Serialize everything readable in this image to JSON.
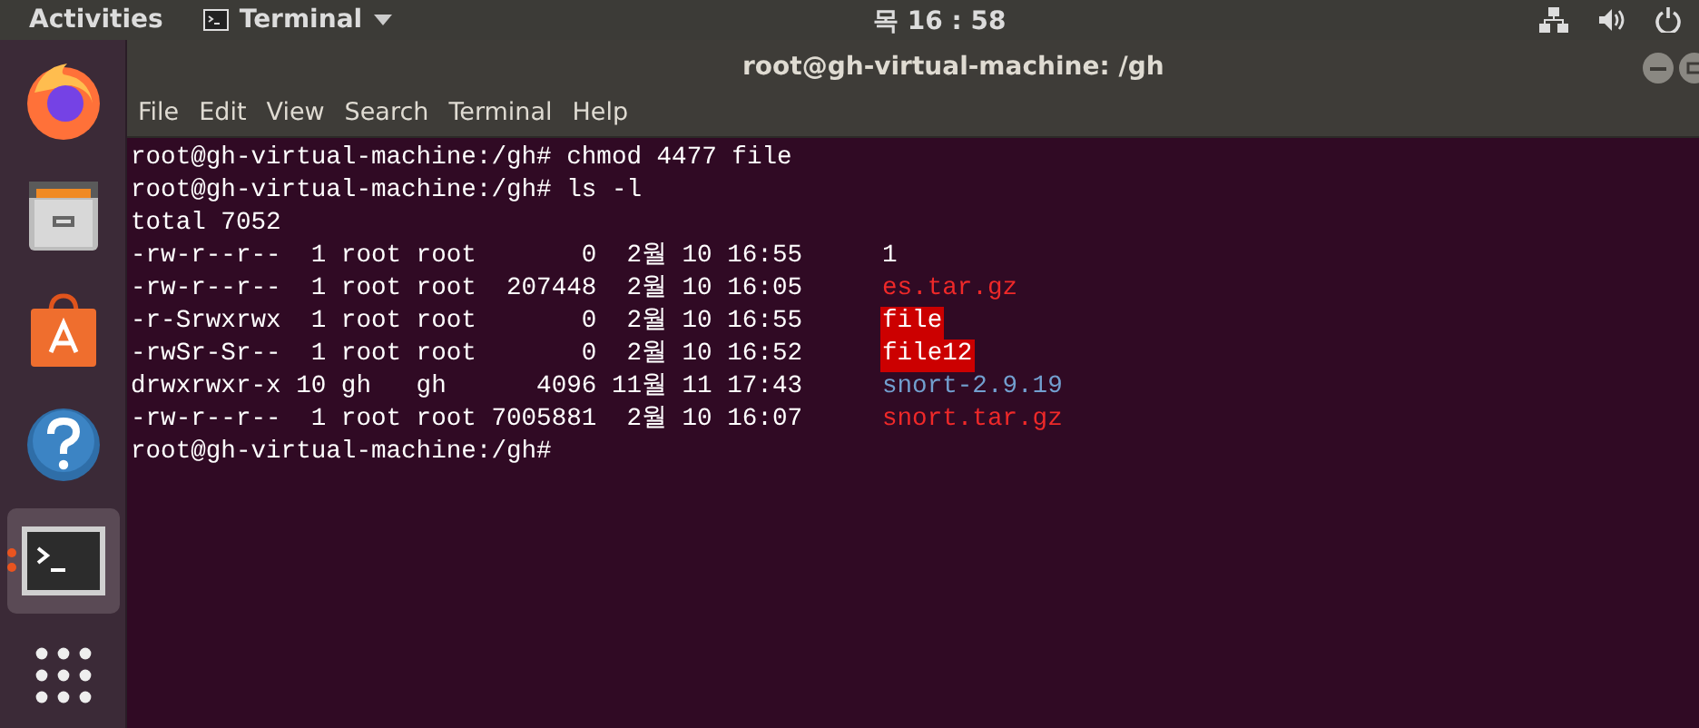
{
  "top_bar": {
    "activities": "Activities",
    "app_menu": "Terminal",
    "clock": "목 16 : 58"
  },
  "dock": {
    "items": [
      {
        "kind": "browser",
        "selected": false,
        "running": false
      },
      {
        "kind": "files",
        "selected": false,
        "running": false
      },
      {
        "kind": "store",
        "selected": false,
        "running": false
      },
      {
        "kind": "help",
        "selected": false,
        "running": false
      },
      {
        "kind": "terminal",
        "selected": true,
        "running": true
      },
      {
        "kind": "apps",
        "selected": false,
        "running": false
      }
    ]
  },
  "window": {
    "title": "root@gh-virtual-machine: /gh",
    "menu": [
      "File",
      "Edit",
      "View",
      "Search",
      "Terminal",
      "Help"
    ]
  },
  "terminal": {
    "lines": [
      {
        "kind": "text",
        "text": "root@gh-virtual-machine:/gh# chmod 4477 file"
      },
      {
        "kind": "text",
        "text": "root@gh-virtual-machine:/gh# ls -l"
      },
      {
        "kind": "text",
        "text": "total 7052"
      },
      {
        "kind": "entry",
        "info": "-rw-r--r--  1 root root       0  2월 10 16:55",
        "name": "1",
        "color": "#ffffff",
        "highlighted": false
      },
      {
        "kind": "entry",
        "info": "-rw-r--r--  1 root root  207448  2월 10 16:05",
        "name": "es.tar.gz",
        "color": "#ef2929",
        "highlighted": false
      },
      {
        "kind": "entry",
        "info": "-r-Srwxrwx  1 root root       0  2월 10 16:55",
        "name": "file",
        "color": "#cc0000",
        "highlighted": true
      },
      {
        "kind": "entry",
        "info": "-rwSr-Sr--  1 root root       0  2월 10 16:52",
        "name": "file12",
        "color": "#cc0000",
        "highlighted": true
      },
      {
        "kind": "entry",
        "info": "drwxrwxr-x 10 gh   gh      4096 11월 11 17:43",
        "name": "snort-2.9.19",
        "color": "#729fcf",
        "highlighted": false
      },
      {
        "kind": "entry",
        "info": "-rw-r--r--  1 root root 7005881  2월 10 16:07",
        "name": "snort.tar.gz",
        "color": "#ef2929",
        "highlighted": false
      },
      {
        "kind": "text",
        "text": "root@gh-virtual-machine:/gh#"
      }
    ]
  }
}
